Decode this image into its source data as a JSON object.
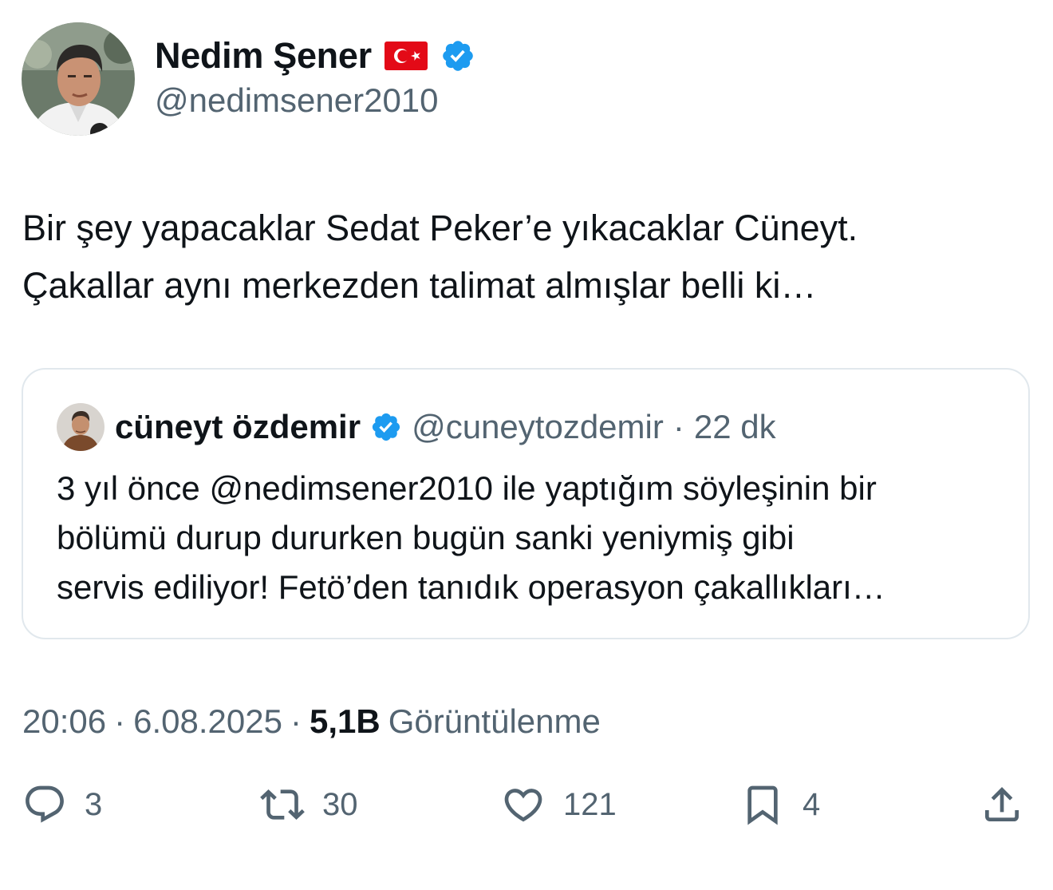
{
  "author": {
    "display_name": "Nedim Şener",
    "handle": "@nedimsener2010",
    "flag_icon": "turkey-flag-icon",
    "verified_icon": "verified-badge-icon",
    "verified_color": "#1d9bf0"
  },
  "tweet": {
    "text_lines": [
      "Bir şey yapacaklar Sedat Peker’e yıkacaklar Cüneyt.",
      "Çakallar aynı merkezden talimat almışlar belli ki…"
    ]
  },
  "quote": {
    "display_name": "cüneyt özdemir",
    "handle": "@cuneytozdemir",
    "separator": "·",
    "time": "22 dk",
    "text_lines": [
      "3 yıl önce @nedimsener2010 ile yaptığım söyleşinin bir",
      "bölümü durup dururken bugün sanki yeniymiş gibi",
      "servis ediliyor! Fetö’den tanıdık operasyon çakallıkları…"
    ]
  },
  "meta": {
    "time": "20:06",
    "sep1": "·",
    "date": "6.08.2025",
    "sep2": "·",
    "views_count": "5,1B",
    "views_label": "Görüntülenme"
  },
  "actions": {
    "reply_count": "3",
    "retweet_count": "30",
    "like_count": "121",
    "bookmark_count": "4"
  },
  "colors": {
    "text": "#0f1419",
    "secondary": "#536471",
    "border": "#e1e8ed",
    "flag_red": "#e30a17"
  }
}
